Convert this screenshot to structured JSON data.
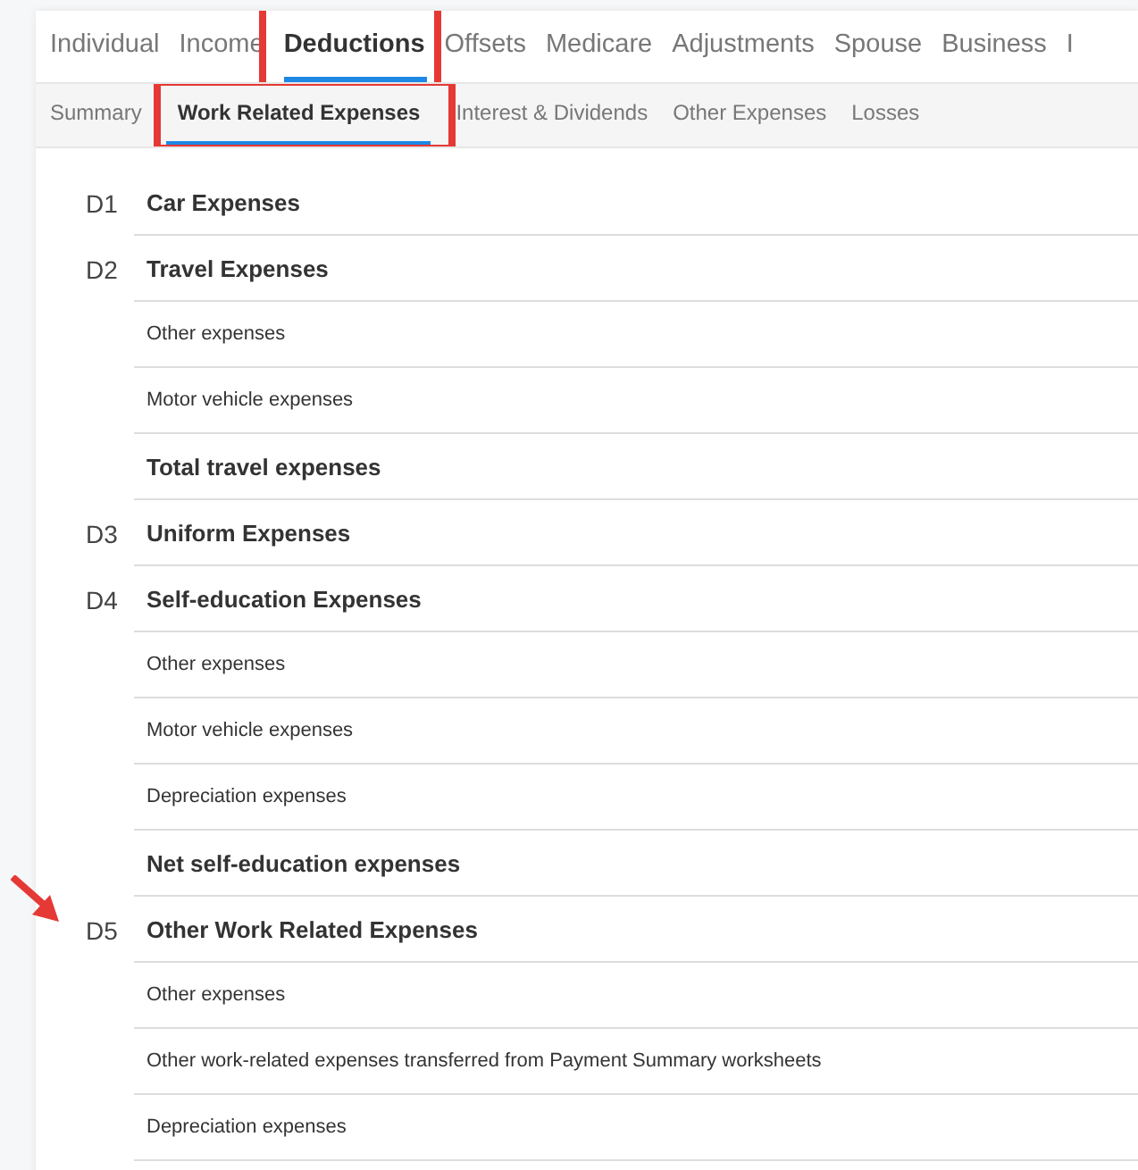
{
  "tabs": [
    {
      "label": "Individual",
      "selected": false,
      "highlighted": false
    },
    {
      "label": "Income",
      "selected": false,
      "highlighted": false
    },
    {
      "label": "Deductions",
      "selected": true,
      "highlighted": true
    },
    {
      "label": "Offsets",
      "selected": false,
      "highlighted": false
    },
    {
      "label": "Medicare",
      "selected": false,
      "highlighted": false
    },
    {
      "label": "Adjustments",
      "selected": false,
      "highlighted": false
    },
    {
      "label": "Spouse",
      "selected": false,
      "highlighted": false
    },
    {
      "label": "Business",
      "selected": false,
      "highlighted": false
    },
    {
      "label": "I",
      "selected": false,
      "highlighted": false
    }
  ],
  "subtabs": [
    {
      "label": "Summary",
      "selected": false,
      "highlighted": false
    },
    {
      "label": "Work Related Expenses",
      "selected": true,
      "highlighted": true
    },
    {
      "label": "Interest & Dividends",
      "selected": false,
      "highlighted": false
    },
    {
      "label": "Other Expenses",
      "selected": false,
      "highlighted": false
    },
    {
      "label": "Losses",
      "selected": false,
      "highlighted": false
    }
  ],
  "rows": [
    {
      "kind": "section",
      "code": "D1",
      "label": "Car Expenses",
      "arrow": false
    },
    {
      "kind": "section",
      "code": "D2",
      "label": "Travel Expenses",
      "arrow": false
    },
    {
      "kind": "item",
      "label": "Other expenses"
    },
    {
      "kind": "item",
      "label": "Motor vehicle expenses"
    },
    {
      "kind": "total",
      "label": "Total travel expenses"
    },
    {
      "kind": "section",
      "code": "D3",
      "label": "Uniform Expenses",
      "arrow": false
    },
    {
      "kind": "section",
      "code": "D4",
      "label": "Self-education Expenses",
      "arrow": false
    },
    {
      "kind": "item",
      "label": "Other expenses"
    },
    {
      "kind": "item",
      "label": "Motor vehicle expenses"
    },
    {
      "kind": "item",
      "label": "Depreciation expenses"
    },
    {
      "kind": "total",
      "label": "Net self-education expenses"
    },
    {
      "kind": "section",
      "code": "D5",
      "label": "Other Work Related Expenses",
      "arrow": true
    },
    {
      "kind": "item",
      "label": "Other expenses"
    },
    {
      "kind": "item",
      "label": "Other work-related expenses transferred from Payment Summary worksheets"
    },
    {
      "kind": "item",
      "label": "Depreciation expenses"
    }
  ]
}
